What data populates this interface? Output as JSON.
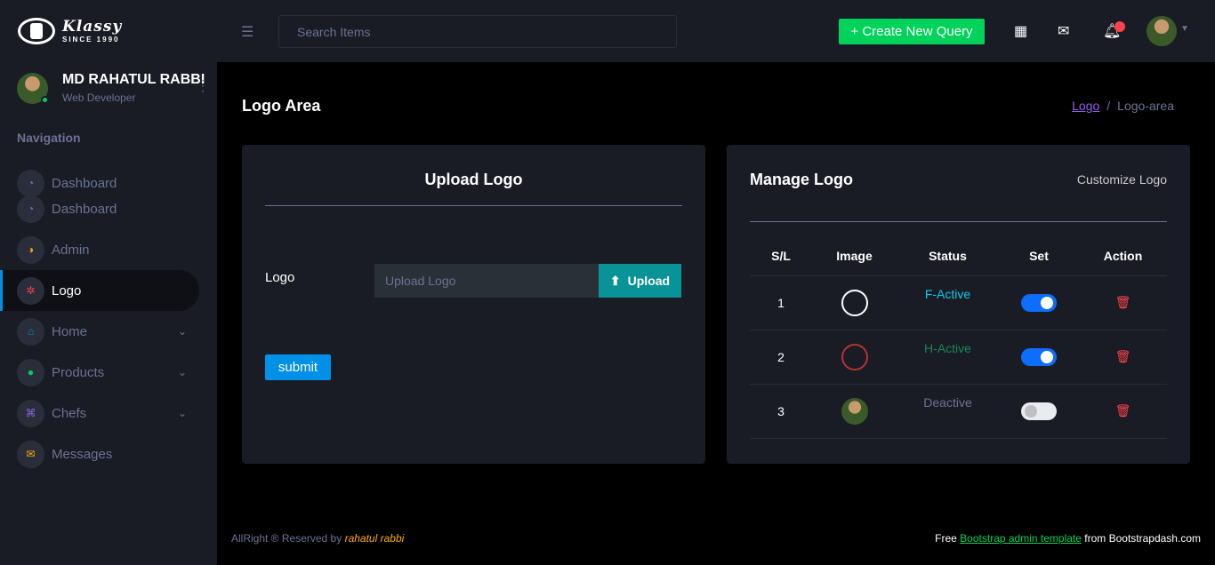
{
  "brand": {
    "name": "Klassy",
    "since": "SINCE 1990"
  },
  "profile": {
    "name": "MD RAHATUL RABBI",
    "role": "Web Developer"
  },
  "nav": {
    "heading": "Navigation",
    "items": [
      {
        "label": "Dashboard",
        "icon": "speedometer-icon",
        "color": "#8f5fe8"
      },
      {
        "label": "Dashboard",
        "icon": "speedometer-icon",
        "color": "#8f5fe8"
      },
      {
        "label": "Admin",
        "icon": "admin-icon",
        "color": "#ffab00"
      },
      {
        "label": "Logo",
        "icon": "logo-icon",
        "color": "#fc424a"
      },
      {
        "label": "Home",
        "icon": "home-icon",
        "color": "#0090e7"
      },
      {
        "label": "Products",
        "icon": "products-icon",
        "color": "#00d25b"
      },
      {
        "label": "Chefs",
        "icon": "chefs-icon",
        "color": "#8f5fe8"
      },
      {
        "label": "Messages",
        "icon": "messages-icon",
        "color": "#ffab00"
      }
    ]
  },
  "topbar": {
    "search_placeholder": "Search Items",
    "create_label": "+ Create New Query"
  },
  "page": {
    "title": "Logo Area",
    "breadcrumb_link": "Logo",
    "breadcrumb_current": "Logo-area"
  },
  "upload": {
    "title": "Upload Logo",
    "field_label": "Logo",
    "input_placeholder": "Upload Logo",
    "upload_label": "Upload",
    "submit_label": "submit"
  },
  "manage": {
    "title": "Manage Logo",
    "customize_label": "Customize Logo",
    "columns": [
      "S/L",
      "Image",
      "Status",
      "Set",
      "Action"
    ],
    "rows": [
      {
        "sl": "1",
        "status": "F-Active",
        "status_color": "#0dcaf0",
        "set": true
      },
      {
        "sl": "2",
        "status": "H-Active",
        "status_color": "#198754",
        "set": true
      },
      {
        "sl": "3",
        "status": "Deactive",
        "status_color": "#6c7293",
        "set": false
      }
    ]
  },
  "footer": {
    "left_prefix": "AllRight ® Reserved by",
    "left_author": "rahatul rabbi",
    "right_prefix": "Free",
    "right_link": "Bootstrap admin template",
    "right_suffix": "from Bootstrapdash.com"
  }
}
